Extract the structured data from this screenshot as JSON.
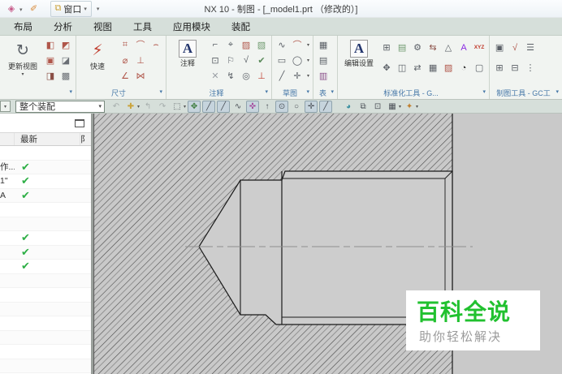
{
  "window": {
    "title": "NX 10 - 制图 - [_model1.prt （修改的）]"
  },
  "quick_access": {
    "icons": [
      {
        "n": "clip-tool-icon",
        "g": "◈",
        "c": "#c75b8a",
        "dd": true
      },
      {
        "n": "brush-tool-icon",
        "g": "✐",
        "c": "#d98a3a",
        "dd": false
      }
    ],
    "window_button": "窗口",
    "window_dd": "▾",
    "customize_dd": "▾"
  },
  "menu_tabs": [
    "布局",
    "分析",
    "视图",
    "工具",
    "应用模块",
    "装配"
  ],
  "ribbon": {
    "groups": [
      {
        "name": "view-group",
        "label": "",
        "rows": 3,
        "big": [
          {
            "n": "update-view-button",
            "label": "更新视图",
            "g": "↻",
            "dd": true
          }
        ],
        "icons": [
          {
            "n": "new-sheet-icon",
            "g": "◧",
            "c": "#b0564a"
          },
          {
            "n": "base-view-icon",
            "g": "▣",
            "c": "#b0564a"
          },
          {
            "n": "projected-view-icon",
            "g": "◨",
            "c": "#8a4f46"
          },
          {
            "n": "section-view-icon",
            "g": "◩",
            "c": "#b0564a"
          },
          {
            "n": "detail-view-icon",
            "g": "◪",
            "c": "#6a6f75"
          },
          {
            "n": "break-view-icon",
            "g": "▩",
            "c": "#6a6f75"
          }
        ]
      },
      {
        "name": "dimension-group",
        "label": "尺寸",
        "rows": 3,
        "big": [
          {
            "n": "rapid-dimension-button",
            "label": "快速",
            "g": "⚡",
            "c": "#c03a2b",
            "dd": false
          }
        ],
        "icons": [
          {
            "n": "linear-dimension-icon",
            "g": "⌗",
            "c": "#b0564a"
          },
          {
            "n": "radial-dimension-icon",
            "g": "⌀",
            "c": "#b0564a"
          },
          {
            "n": "angular-dimension-icon",
            "g": "∠",
            "c": "#b0564a"
          },
          {
            "n": "chamfer-dimension-icon",
            "g": "⌒",
            "c": "#b0564a"
          },
          {
            "n": "thickness-dimension-icon",
            "g": "⊥",
            "c": "#b0564a"
          },
          {
            "n": "ordinate-dimension-icon",
            "g": "⋈",
            "c": "#b0564a"
          },
          {
            "n": "arc-length-dimension-icon",
            "g": "⌢",
            "c": "#b0564a"
          }
        ]
      },
      {
        "name": "annotation-group",
        "label": "注释",
        "rows": 3,
        "big": [
          {
            "n": "note-button",
            "label": "注释",
            "g": "A",
            "c": "#23356d",
            "boxA": true,
            "dd": false
          }
        ],
        "icons": [
          {
            "n": "feature-control-frame-icon",
            "g": "⌐",
            "c": "#5a5f66"
          },
          {
            "n": "datum-feature-icon",
            "g": "⊡",
            "c": "#5a5f66"
          },
          {
            "n": "no-symbol-icon",
            "g": "✕",
            "c": "#9a9fa5"
          },
          {
            "n": "datum-target-icon",
            "g": "⌖",
            "c": "#5a5f66",
            "dd": true
          },
          {
            "n": "balloon-icon",
            "g": "⚐",
            "c": "#5a5f66"
          },
          {
            "n": "intersection-symbol-icon",
            "g": "↯",
            "c": "#5a5f66"
          },
          {
            "n": "crosshatch-icon",
            "g": "▨",
            "c": "#b0564a"
          },
          {
            "n": "surface-finish-icon",
            "g": "√",
            "c": "#5a5f66"
          },
          {
            "n": "magnifier-icon",
            "g": "◎",
            "c": "#5a5f66"
          },
          {
            "n": "image-icon",
            "g": "▧",
            "c": "#6f9a6f"
          },
          {
            "n": "check-symbol-icon",
            "g": "✔",
            "c": "#5a8a5a"
          },
          {
            "n": "weld-symbol-icon",
            "g": "⊥",
            "c": "#c03a2b"
          }
        ]
      },
      {
        "name": "sketch-group",
        "label": "草图",
        "rows": 3,
        "dd_col": 3,
        "big": [],
        "icons": [
          {
            "n": "profile-icon",
            "g": "∿",
            "c": "#5a5f66"
          },
          {
            "n": "rectangle-icon",
            "g": "▭",
            "c": "#5a5f66"
          },
          {
            "n": "line-icon",
            "g": "╱",
            "c": "#5a5f66"
          },
          {
            "n": "arc-icon",
            "g": "⌒",
            "c": "#b0564a"
          },
          {
            "n": "circle-icon",
            "g": "◯",
            "c": "#5a5f66"
          },
          {
            "n": "point-icon",
            "g": "✛",
            "c": "#5a5f66"
          }
        ]
      },
      {
        "name": "table-group",
        "label": "表",
        "rows": 3,
        "big": [],
        "icons": [
          {
            "n": "table-icon",
            "g": "▦",
            "c": "#5a5f66"
          },
          {
            "n": "tabular-note-icon",
            "g": "▤",
            "c": "#5a5f66"
          },
          {
            "n": "parts-list-icon",
            "g": "▥",
            "c": "#8a4f8a"
          }
        ]
      },
      {
        "name": "standardization-group",
        "label": "标准化工具 - G...",
        "rows": 2,
        "big": [
          {
            "n": "edit-settings-button",
            "label": "编辑设置",
            "g": "A",
            "c": "#23356d",
            "boxA": true,
            "dd": false
          }
        ],
        "icons": [
          {
            "n": "attribute-sync-icon",
            "g": "⊞",
            "c": "#5a5f66"
          },
          {
            "n": "replace-template-icon",
            "g": "✥",
            "c": "#5a5f66"
          },
          {
            "n": "title-block-icon",
            "g": "▤",
            "c": "#6f9a6f"
          },
          {
            "n": "borders-zones-icon",
            "g": "◫",
            "c": "#5a5f66"
          },
          {
            "n": "cell-settings-icon",
            "g": "⚙",
            "c": "#5a5f66"
          },
          {
            "n": "export-sheet-icon",
            "g": "⇄",
            "c": "#5a5f66"
          },
          {
            "n": "import-sheet-icon",
            "g": "⇆",
            "c": "#8a4f46"
          },
          {
            "n": "block-icon",
            "g": "▦",
            "c": "#5a5f66"
          },
          {
            "n": "triangle-mark-icon",
            "g": "△",
            "c": "#5a5f66"
          },
          {
            "n": "hatch-tool-icon",
            "g": "▨",
            "c": "#b0564a"
          },
          {
            "n": "text-style-icon",
            "g": "A",
            "c": "#8a2be2"
          },
          {
            "n": "ball-mark-icon",
            "g": "◔",
            "c": "#2b2b2b"
          },
          {
            "n": "xyz-coordinate-icon",
            "g": "XYZ",
            "c": "#c03a2b"
          },
          {
            "n": "frame-icon",
            "g": "▢",
            "c": "#5a5f66"
          }
        ]
      },
      {
        "name": "drafting-tools-group",
        "label": "制图工具 - GC工",
        "rows": 2,
        "big": [],
        "icons": [
          {
            "n": "drawing-frame-icon",
            "g": "▣",
            "c": "#5a5f66"
          },
          {
            "n": "sheet-settings-icon",
            "g": "⊞",
            "c": "#5a5f66"
          },
          {
            "n": "roughness-tool-icon",
            "g": "√",
            "c": "#b0564a"
          },
          {
            "n": "list-tool-icon",
            "g": "⊟",
            "c": "#5a5f66"
          },
          {
            "n": "align-tool-icon",
            "g": "☰",
            "c": "#5a5f66"
          },
          {
            "n": "more-tools-icon",
            "g": "⋮",
            "c": "#5a5f66"
          }
        ]
      }
    ]
  },
  "selection_bar": {
    "partial_arrow": "▾",
    "scope_value": "整个装配",
    "scope_arrow": "▾",
    "icons": [
      {
        "n": "deselect-icon",
        "g": "↶",
        "s": "disabled"
      },
      {
        "n": "select-add-icon",
        "g": "✚",
        "s": "normal",
        "c": "#caa43c",
        "dd": true
      },
      {
        "n": "previous-selection-icon",
        "g": "↰",
        "s": "disabled"
      },
      {
        "n": "recall-selection-icon",
        "g": "↷",
        "s": "disabled"
      },
      {
        "n": "marquee-select-icon",
        "g": "⬚",
        "s": "normal",
        "dd": true
      },
      {
        "n": "snap-point-toggle-icon",
        "g": "✥",
        "s": "active",
        "c": "#3a7a3a"
      },
      {
        "n": "endpoint-snap-icon",
        "g": "╱",
        "s": "active"
      },
      {
        "n": "midpoint-snap-icon",
        "g": "╱",
        "s": "active"
      },
      {
        "n": "point-on-curve-snap-icon",
        "g": "∿",
        "s": "normal"
      },
      {
        "n": "pole-snap-icon",
        "g": "✜",
        "s": "active",
        "c": "#a4489c"
      },
      {
        "n": "vertex-snap-icon",
        "g": "↑",
        "s": "normal"
      },
      {
        "n": "center-snap-icon",
        "g": "⊙",
        "s": "active"
      },
      {
        "n": "quadrant-snap-icon",
        "g": "○",
        "s": "normal"
      },
      {
        "n": "intersection-snap-icon",
        "g": "✛",
        "s": "active"
      },
      {
        "n": "point-on-line-snap-icon",
        "g": "╱",
        "s": "active"
      },
      {
        "n": "face-snap-icon",
        "g": "◕",
        "s": "normal",
        "c": "#3a8fa0",
        "gap": true
      },
      {
        "n": "window-tool-icon",
        "g": "⧉",
        "s": "normal"
      },
      {
        "n": "view-tool-icon",
        "g": "⊡",
        "s": "normal"
      },
      {
        "n": "display-tool-icon",
        "g": "▦",
        "s": "normal",
        "dd": true
      },
      {
        "n": "measure-tool-icon",
        "g": "✦",
        "s": "normal",
        "c": "#c08030",
        "dd": true
      }
    ]
  },
  "navigator": {
    "columns": {
      "c1": "",
      "c2": "最新",
      "c3": "阝"
    },
    "rows": [
      {
        "label": "",
        "check": false
      },
      {
        "label": "作...",
        "check": true
      },
      {
        "label": "1\"",
        "check": true
      },
      {
        "label": "A",
        "check": true
      },
      {
        "label": "",
        "check": false
      },
      {
        "label": "",
        "check": false
      },
      {
        "label": "",
        "check": true
      },
      {
        "label": "",
        "check": true
      },
      {
        "label": "",
        "check": true
      },
      {
        "label": "",
        "check": false
      },
      {
        "label": "",
        "check": false
      },
      {
        "label": "",
        "check": false
      },
      {
        "label": "",
        "check": false
      },
      {
        "label": "",
        "check": false
      },
      {
        "label": "",
        "check": false
      },
      {
        "label": "",
        "check": false
      }
    ],
    "check_glyph": "✔"
  },
  "watermark": {
    "title": "百科全说",
    "subtitle": "助你轻松解决",
    "accent": "#21c12f"
  },
  "colors": {
    "menubar_bg": "#d6dfda",
    "ribbon_bg": "#f1f4f1",
    "group_label": "#4677a8",
    "canvas_bg": "#c9c9c9",
    "check_green": "#2eaf46",
    "watermark_green": "#21c12f"
  }
}
